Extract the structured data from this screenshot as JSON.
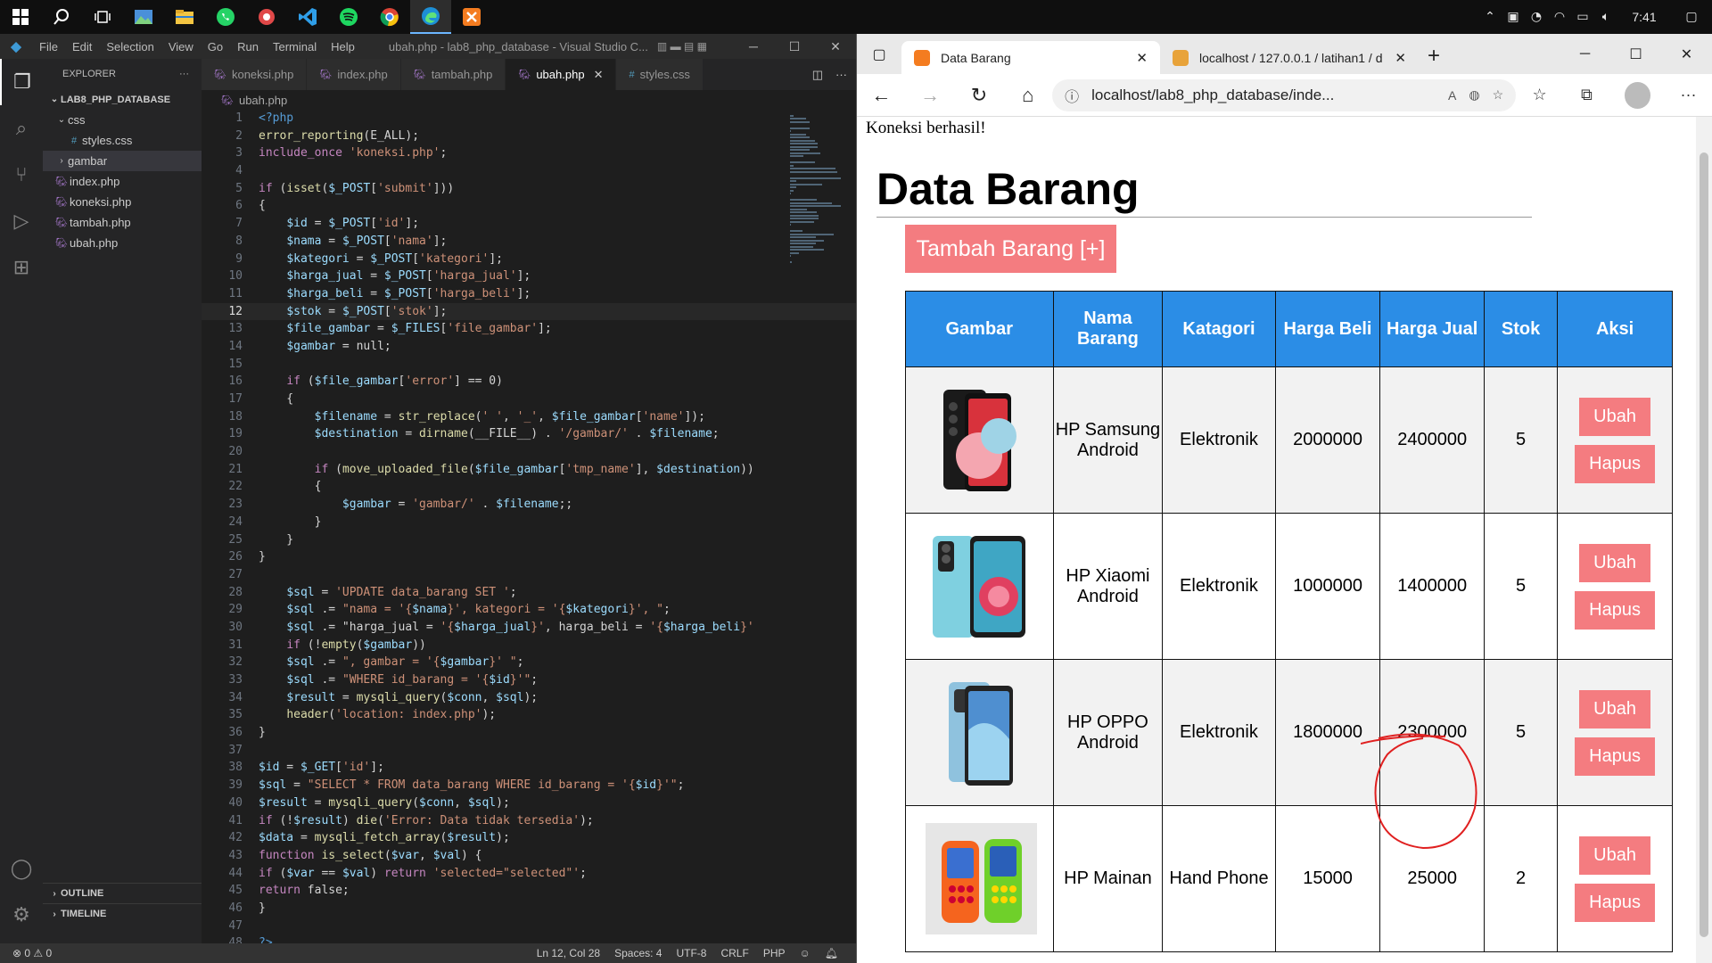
{
  "taskbar": {
    "clock": "7:41",
    "icons": [
      "windows-start",
      "search",
      "task-view",
      "photos",
      "file-explorer",
      "whatsapp",
      "app",
      "vscode",
      "spotify",
      "chrome",
      "edge",
      "xampp"
    ]
  },
  "vscode": {
    "menu": [
      "File",
      "Edit",
      "Selection",
      "View",
      "Go",
      "Run",
      "Terminal",
      "Help"
    ],
    "window_title": "ubah.php - lab8_php_database - Visual Studio C...",
    "explorer_header": "EXPLORER",
    "folder": "LAB8_PHP_DATABASE",
    "tree": [
      {
        "label": "css",
        "type": "folder-open",
        "indent": 1
      },
      {
        "label": "styles.css",
        "type": "css",
        "indent": 2
      },
      {
        "label": "gambar",
        "type": "folder",
        "indent": 1
      },
      {
        "label": "index.php",
        "type": "php",
        "indent": 1
      },
      {
        "label": "koneksi.php",
        "type": "php",
        "indent": 1
      },
      {
        "label": "tambah.php",
        "type": "php",
        "indent": 1
      },
      {
        "label": "ubah.php",
        "type": "php",
        "indent": 1
      }
    ],
    "outline": "OUTLINE",
    "timeline": "TIMELINE",
    "tabs": [
      "koneksi.php",
      "index.php",
      "tambah.php",
      "ubah.php",
      "styles.css"
    ],
    "active_tab": "ubah.php",
    "breadcrumb": "ubah.php",
    "code_lines": [
      "<?php",
      "error_reporting(E_ALL);",
      "include_once 'koneksi.php';",
      "",
      "if (isset($_POST['submit']))",
      "{",
      "    $id = $_POST['id'];",
      "    $nama = $_POST['nama'];",
      "    $kategori = $_POST['kategori'];",
      "    $harga_jual = $_POST['harga_jual'];",
      "    $harga_beli = $_POST['harga_beli'];",
      "    $stok = $_POST['stok'];",
      "    $file_gambar = $_FILES['file_gambar'];",
      "    $gambar = null;",
      "",
      "    if ($file_gambar['error'] == 0)",
      "    {",
      "        $filename = str_replace(' ', '_', $file_gambar['name']);",
      "        $destination = dirname(__FILE__) . '/gambar/' . $filename;",
      "",
      "        if (move_uploaded_file($file_gambar['tmp_name'], $destination))",
      "        {",
      "            $gambar = 'gambar/' . $filename;;",
      "        }",
      "    }",
      "}",
      "",
      "    $sql = 'UPDATE data_barang SET ';",
      "    $sql .= \"nama = '{$nama}', kategori = '{$kategori}', \";",
      "    $sql .= \"harga_jual = '{$harga_jual}', harga_beli = '{$harga_beli}'",
      "    if (!empty($gambar))",
      "    $sql .= \", gambar = '{$gambar}' \";",
      "    $sql .= \"WHERE id_barang = '{$id}'\";",
      "    $result = mysqli_query($conn, $sql);",
      "    header('location: index.php');",
      "}",
      "",
      "$id = $_GET['id'];",
      "$sql = \"SELECT * FROM data_barang WHERE id_barang = '{$id}'\";",
      "$result = mysqli_query($conn, $sql);",
      "if (!$result) die('Error: Data tidak tersedia');",
      "$data = mysqli_fetch_array($result);",
      "function is_select($var, $val) {",
      "if ($var == $val) return 'selected=\"selected\"';",
      "return false;",
      "}",
      "",
      "?>"
    ],
    "current_line": 12,
    "status": {
      "problems": "⊗ 0 ⚠ 0",
      "position": "Ln 12, Col 28",
      "spaces": "Spaces: 4",
      "encoding": "UTF-8",
      "eol": "CRLF",
      "language": "PHP"
    }
  },
  "browser": {
    "tabs": [
      {
        "title": "Data Barang",
        "active": true,
        "fav_color": "#f47c20"
      },
      {
        "title": "localhost / 127.0.0.1 / latihan1 / d",
        "active": false,
        "fav_color": "#e8a33a"
      }
    ],
    "url": "localhost/lab8_php_database/inde...",
    "page": {
      "connection": "Koneksi berhasil!",
      "heading": "Data Barang",
      "add_button": "Tambah Barang [+]",
      "columns": [
        "Gambar",
        "Nama Barang",
        "Katagori",
        "Harga Beli",
        "Harga Jual",
        "Stok",
        "Aksi"
      ],
      "rows": [
        {
          "nama": "HP Samsung Android",
          "kategori": "Elektronik",
          "harga_beli": "2000000",
          "harga_jual": "2400000",
          "stok": "5",
          "img": "samsung"
        },
        {
          "nama": "HP Xiaomi Android",
          "kategori": "Elektronik",
          "harga_beli": "1000000",
          "harga_jual": "1400000",
          "stok": "5",
          "img": "xiaomi"
        },
        {
          "nama": "HP OPPO Android",
          "kategori": "Elektronik",
          "harga_beli": "1800000",
          "harga_jual": "2300000",
          "stok": "5",
          "img": "oppo"
        },
        {
          "nama": "HP Mainan",
          "kategori": "Hand Phone",
          "harga_beli": "15000",
          "harga_jual": "25000",
          "stok": "2",
          "img": "toy"
        }
      ],
      "edit_label": "Ubah",
      "delete_label": "Hapus"
    }
  },
  "colors": {
    "accent_button": "#f47c80",
    "table_header": "#2b8de6",
    "annotation": "#e02020"
  }
}
